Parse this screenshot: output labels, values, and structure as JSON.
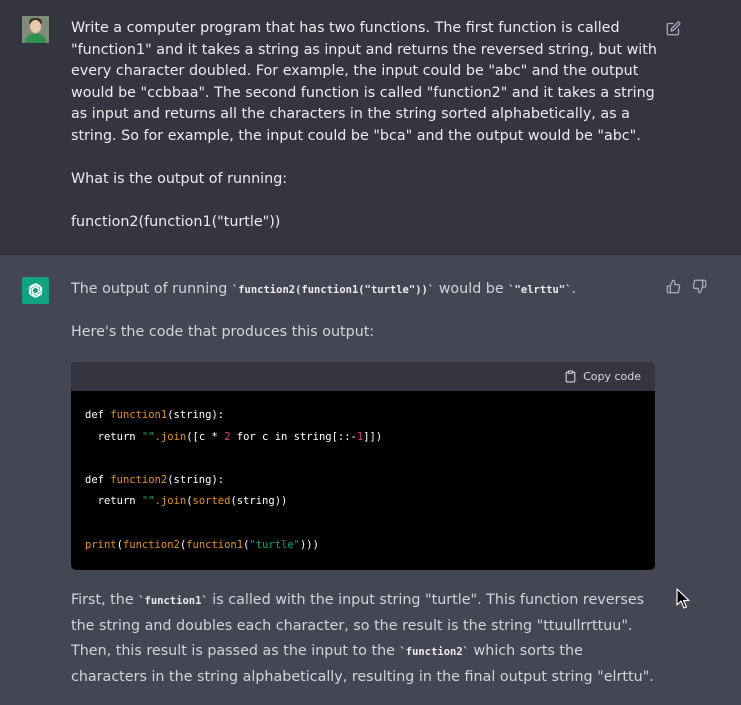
{
  "user": {
    "paragraphs": [
      "Write a computer program that has two functions. The first function is called \"function1\" and it takes a string as input and returns the reversed string, but with every character doubled. For example, the input could be \"abc\" and the output would be \"ccbbaa\". The second function is called \"function2\" and it takes a string as input and returns all the characters in the string sorted alphabetically, as a string. So for example, the input could be \"bca\" and the output would be \"abc\".",
      "What is the output of running:",
      "function2(function1(\"turtle\"))"
    ]
  },
  "assistant": {
    "p1_pre": "The output of running ",
    "p1_code": "`function2(function1(\"turtle\"))`",
    "p1_mid": " would be ",
    "p1_code2": "`\"elrttu\"`",
    "p1_post": ".",
    "p2": "Here's the code that produces this output:",
    "copy_label": "Copy code",
    "code": {
      "l1_def": "def",
      "l1_name": "function1",
      "l1_rest": "(string):",
      "l2_ret": "return",
      "l2_str": "\"\"",
      "l2_join": ".join",
      "l2_a": "([c * ",
      "l2_num": "2",
      "l2_b": " for c in string[::-",
      "l2_num2": "1",
      "l2_c": "]])",
      "l4_def": "def",
      "l4_name": "function2",
      "l4_rest": "(string):",
      "l5_ret": "return",
      "l5_str": "\"\"",
      "l5_join": ".join",
      "l5_open": "(",
      "l5_sorted": "sorted",
      "l5_rest": "(string))",
      "l7_print": "print",
      "l7_open": "(",
      "l7_f2": "function2",
      "l7_open2": "(",
      "l7_f1": "function1",
      "l7_open3": "(",
      "l7_str": "\"turtle\"",
      "l7_close": ")))"
    },
    "p3_a": "First, the ",
    "p3_code1": "`function1`",
    "p3_b": " is called with the input string \"turtle\". This function reverses the string and doubles each character, so the result is the string \"ttuullrrttuu\". Then, this result is passed as the input to the ",
    "p3_code2": "`function2`",
    "p3_c": " which sorts the characters in the string alphabetically, resulting in the final output string \"elrttu\"."
  },
  "icons": {
    "user_avatar": "user-avatar",
    "bot_avatar": "openai-logo-icon",
    "edit": "edit-icon",
    "thumbs_up": "thumbs-up-icon",
    "thumbs_down": "thumbs-down-icon",
    "clipboard": "clipboard-icon",
    "cursor": "mouse-cursor-icon"
  },
  "colors": {
    "user_bg": "#343541",
    "assistant_bg": "#444654",
    "bot_avatar": "#10a37f",
    "code_bg": "#000000"
  }
}
